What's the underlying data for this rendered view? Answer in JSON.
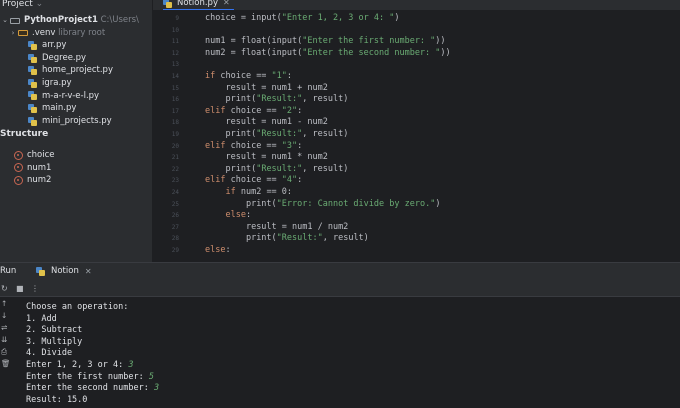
{
  "project_panel": {
    "title": "Project",
    "root": {
      "name": "PythonProject1",
      "path": "C:\\Users\\"
    },
    "venv": {
      "name": ".venv",
      "note": "library root"
    },
    "files": [
      "arr.py",
      "Degree.py",
      "home_project.py",
      "igra.py",
      "m-a-r-v-e-l.py",
      "main.py",
      "mini_projects.py"
    ]
  },
  "structure": {
    "title": "Structure",
    "items": [
      "choice",
      "num1",
      "num2"
    ]
  },
  "editor": {
    "tab": "Notion.py",
    "line_numbers": [
      "9",
      "10",
      "11",
      "12",
      "13",
      "14",
      "15",
      "16",
      "17",
      "18",
      "19",
      "20",
      "21",
      "22",
      "23",
      "24",
      "25",
      "26",
      "27",
      "28",
      "29"
    ],
    "lines": [
      {
        "ind": "",
        "parts": [
          [
            "t",
            "choice = input("
          ],
          [
            "s",
            "\"Enter 1, 2, 3 or 4: \""
          ],
          [
            "t",
            ")"
          ]
        ]
      },
      {
        "ind": "",
        "parts": []
      },
      {
        "ind": "",
        "parts": [
          [
            "t",
            "num1 = float(input("
          ],
          [
            "s",
            "\"Enter the first number: \""
          ],
          [
            "t",
            "))"
          ]
        ]
      },
      {
        "ind": "",
        "parts": [
          [
            "t",
            "num2 = float(input("
          ],
          [
            "s",
            "\"Enter the second number: \""
          ],
          [
            "t",
            "))"
          ]
        ]
      },
      {
        "ind": "",
        "parts": []
      },
      {
        "ind": "",
        "parts": [
          [
            "k",
            "if"
          ],
          [
            "t",
            " choice == "
          ],
          [
            "s",
            "\"1\""
          ],
          [
            "t",
            ":"
          ]
        ]
      },
      {
        "ind": "    ",
        "parts": [
          [
            "t",
            "result = num1 + num2"
          ]
        ]
      },
      {
        "ind": "    ",
        "parts": [
          [
            "t",
            "print("
          ],
          [
            "s",
            "\"Result:\""
          ],
          [
            "t",
            ", result)"
          ]
        ]
      },
      {
        "ind": "",
        "parts": [
          [
            "k",
            "elif"
          ],
          [
            "t",
            " choice == "
          ],
          [
            "s",
            "\"2\""
          ],
          [
            "t",
            ":"
          ]
        ]
      },
      {
        "ind": "    ",
        "parts": [
          [
            "t",
            "result = num1 - num2"
          ]
        ]
      },
      {
        "ind": "    ",
        "parts": [
          [
            "t",
            "print("
          ],
          [
            "s",
            "\"Result:\""
          ],
          [
            "t",
            ", result)"
          ]
        ]
      },
      {
        "ind": "",
        "parts": [
          [
            "k",
            "elif"
          ],
          [
            "t",
            " choice == "
          ],
          [
            "s",
            "\"3\""
          ],
          [
            "t",
            ":"
          ]
        ]
      },
      {
        "ind": "    ",
        "parts": [
          [
            "t",
            "result = num1 * num2"
          ]
        ]
      },
      {
        "ind": "    ",
        "parts": [
          [
            "t",
            "print("
          ],
          [
            "s",
            "\"Result:\""
          ],
          [
            "t",
            ", result)"
          ]
        ]
      },
      {
        "ind": "",
        "parts": [
          [
            "k",
            "elif"
          ],
          [
            "t",
            " choice == "
          ],
          [
            "s",
            "\"4\""
          ],
          [
            "t",
            ":"
          ]
        ]
      },
      {
        "ind": "    ",
        "parts": [
          [
            "k",
            "if"
          ],
          [
            "t",
            " num2 == 0:"
          ]
        ]
      },
      {
        "ind": "        ",
        "parts": [
          [
            "t",
            "print("
          ],
          [
            "s",
            "\"Error: Cannot divide by zero.\""
          ],
          [
            "t",
            ")"
          ]
        ]
      },
      {
        "ind": "    ",
        "parts": [
          [
            "k",
            "else"
          ],
          [
            "t",
            ":"
          ]
        ]
      },
      {
        "ind": "        ",
        "parts": [
          [
            "t",
            "result = num1 / num2"
          ]
        ]
      },
      {
        "ind": "        ",
        "parts": [
          [
            "t",
            "print("
          ],
          [
            "s",
            "\"Result:\""
          ],
          [
            "t",
            ", result)"
          ]
        ]
      },
      {
        "ind": "",
        "parts": [
          [
            "k",
            "else"
          ],
          [
            "t",
            ":"
          ]
        ]
      }
    ]
  },
  "run_panel": {
    "label": "Run",
    "tab": "Notion",
    "output": [
      {
        "text": "Choose an operation:",
        "input": ""
      },
      {
        "text": "1. Add",
        "input": ""
      },
      {
        "text": "2. Subtract",
        "input": ""
      },
      {
        "text": "3. Multiply",
        "input": ""
      },
      {
        "text": "4. Divide",
        "input": ""
      },
      {
        "text": "Enter 1, 2, 3 or 4: ",
        "input": "3"
      },
      {
        "text": "Enter the first number: ",
        "input": "5"
      },
      {
        "text": "Enter the second number: ",
        "input": "3"
      },
      {
        "text": "Result: 15.0",
        "input": ""
      }
    ]
  },
  "colors": {
    "background": "#1e1f22",
    "panel": "#2b2d30",
    "keyword": "#cf8e6d",
    "string": "#6aab73",
    "accent": "#3574f0",
    "variable_icon": "#c76652"
  }
}
